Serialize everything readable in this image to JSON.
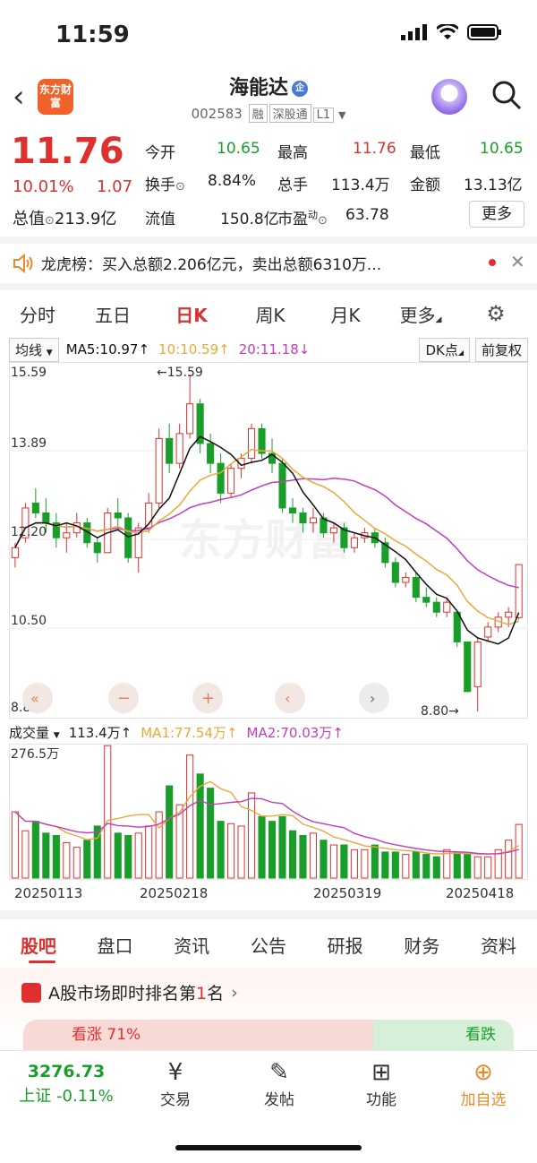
{
  "status": {
    "time": "11:59"
  },
  "header": {
    "logo_text": "东方财富",
    "name": "海能达",
    "name_tag": "企",
    "code": "002583",
    "badges": [
      "融",
      "深股通",
      "L1"
    ]
  },
  "quote": {
    "price": "11.76",
    "change_pct": "10.01%",
    "change": "1.07",
    "mktcap_label": "总值",
    "mktcap": "213.9亿",
    "float_label": "流值",
    "float_cap": "150.8亿",
    "pe_label": "市盈",
    "pe_sup": "动",
    "pe": "63.78",
    "open_label": "今开",
    "open": "10.65",
    "high_label": "最高",
    "high": "11.76",
    "low_label": "最低",
    "low": "10.65",
    "turnover_label": "换手",
    "turnover": "8.84%",
    "volume_label": "总手",
    "volume": "113.4万",
    "amount_label": "金额",
    "amount": "13.13亿",
    "more_label": "更多"
  },
  "notice": {
    "text": "龙虎榜：买入总额2.206亿元，卖出总额6310万..."
  },
  "chart_tabs": [
    "分时",
    "五日",
    "日K",
    "周K",
    "月K",
    "更多"
  ],
  "active_chart_tab": "日K",
  "ma_bar": {
    "selector": "均线",
    "ma5": "MA5:10.97↑",
    "ma10": "10:10.59↑",
    "ma20": "20:11.18↓",
    "dk": "DK点",
    "adj": "前复权"
  },
  "kline_axis": {
    "y1": "15.59",
    "y2": "13.89",
    "y3": "12.20",
    "y4": "10.50",
    "y5": "8.80",
    "max_note": "←15.59",
    "min_note": "8.80→"
  },
  "watermark": "东方财富",
  "volume_bar": {
    "selector": "成交量",
    "vol": "113.4万↑",
    "ma1": "MA1:77.54万↑",
    "ma2": "MA2:70.03万↑",
    "max": "276.5万"
  },
  "dates": [
    "20250113",
    "20250218",
    "20250319",
    "20250418"
  ],
  "info_tabs": [
    "股吧",
    "盘口",
    "资讯",
    "公告",
    "研报",
    "财务",
    "资料"
  ],
  "rank": {
    "text_a": "A股市场即时排名第",
    "rank": "1",
    "text_b": "名"
  },
  "sentiment": {
    "bull": "看涨 71%",
    "bear": "看跌"
  },
  "bottom_nav": {
    "index_value": "3276.73",
    "index_label": "上证 -0.11%",
    "items": [
      "交易",
      "发帖",
      "功能",
      "加自选"
    ]
  },
  "colors": {
    "up": "#e0302d",
    "down": "#1a9e2a",
    "ma5": "#111111",
    "ma10": "#e8a93a",
    "ma20": "#c23cbf"
  },
  "chart_data": {
    "type": "candlestick",
    "ylim": [
      8.8,
      15.59
    ],
    "candles": [
      [
        11.9,
        12.2,
        11.7,
        12.1
      ],
      [
        12.3,
        13.0,
        12.2,
        12.9
      ],
      [
        13.0,
        13.3,
        12.7,
        12.8
      ],
      [
        12.8,
        13.1,
        12.4,
        12.6
      ],
      [
        12.6,
        12.8,
        12.1,
        12.3
      ],
      [
        12.3,
        12.6,
        12.0,
        12.4
      ],
      [
        12.4,
        12.8,
        12.3,
        12.6
      ],
      [
        12.6,
        12.7,
        12.1,
        12.2
      ],
      [
        12.2,
        12.3,
        11.8,
        12.0
      ],
      [
        12.0,
        12.9,
        12.0,
        12.8
      ],
      [
        12.8,
        13.1,
        12.5,
        12.7
      ],
      [
        12.7,
        12.8,
        11.8,
        11.9
      ],
      [
        11.9,
        12.6,
        11.6,
        12.5
      ],
      [
        12.5,
        13.2,
        12.4,
        13.0
      ],
      [
        13.0,
        14.5,
        12.9,
        14.3
      ],
      [
        14.3,
        14.6,
        13.6,
        13.8
      ],
      [
        13.8,
        14.6,
        13.7,
        14.4
      ],
      [
        14.4,
        15.59,
        14.3,
        15.0
      ],
      [
        15.0,
        15.1,
        14.0,
        14.2
      ],
      [
        14.2,
        14.4,
        13.6,
        13.8
      ],
      [
        13.8,
        14.0,
        13.0,
        13.2
      ],
      [
        13.2,
        13.8,
        13.1,
        13.7
      ],
      [
        13.7,
        14.0,
        13.5,
        13.9
      ],
      [
        13.9,
        14.6,
        13.8,
        14.5
      ],
      [
        14.5,
        14.6,
        13.9,
        14.0
      ],
      [
        14.0,
        14.3,
        13.6,
        13.8
      ],
      [
        13.8,
        13.9,
        12.8,
        12.9
      ],
      [
        12.9,
        13.1,
        12.6,
        12.8
      ],
      [
        12.8,
        12.9,
        12.4,
        12.6
      ],
      [
        12.6,
        12.9,
        12.4,
        12.7
      ],
      [
        12.7,
        12.8,
        12.3,
        12.4
      ],
      [
        12.4,
        12.6,
        12.2,
        12.5
      ],
      [
        12.5,
        12.6,
        12.0,
        12.1
      ],
      [
        12.1,
        12.4,
        12.0,
        12.3
      ],
      [
        12.3,
        12.5,
        12.2,
        12.4
      ],
      [
        12.4,
        12.5,
        12.1,
        12.2
      ],
      [
        12.2,
        12.3,
        11.7,
        11.8
      ],
      [
        11.8,
        11.9,
        11.3,
        11.4
      ],
      [
        11.4,
        11.6,
        11.3,
        11.5
      ],
      [
        11.5,
        11.6,
        11.0,
        11.1
      ],
      [
        11.1,
        11.3,
        10.9,
        11.0
      ],
      [
        11.0,
        11.1,
        10.7,
        10.8
      ],
      [
        10.8,
        11.1,
        10.7,
        11.0
      ],
      [
        10.8,
        10.8,
        10.1,
        10.2
      ],
      [
        10.2,
        10.2,
        9.2,
        9.2
      ],
      [
        9.3,
        10.3,
        8.8,
        10.2
      ],
      [
        10.3,
        10.6,
        10.2,
        10.5
      ],
      [
        10.5,
        10.8,
        10.4,
        10.7
      ],
      [
        10.7,
        10.9,
        10.5,
        10.8
      ],
      [
        10.69,
        11.76,
        10.65,
        11.76
      ]
    ],
    "volumes": [
      140,
      100,
      120,
      95,
      90,
      75,
      65,
      80,
      110,
      280,
      95,
      90,
      95,
      110,
      140,
      195,
      155,
      260,
      220,
      190,
      120,
      115,
      110,
      180,
      130,
      120,
      130,
      100,
      90,
      95,
      80,
      70,
      70,
      60,
      60,
      70,
      55,
      55,
      50,
      55,
      50,
      45,
      60,
      55,
      50,
      45,
      45,
      60,
      80,
      113.4
    ],
    "vol_max": 276.5
  }
}
